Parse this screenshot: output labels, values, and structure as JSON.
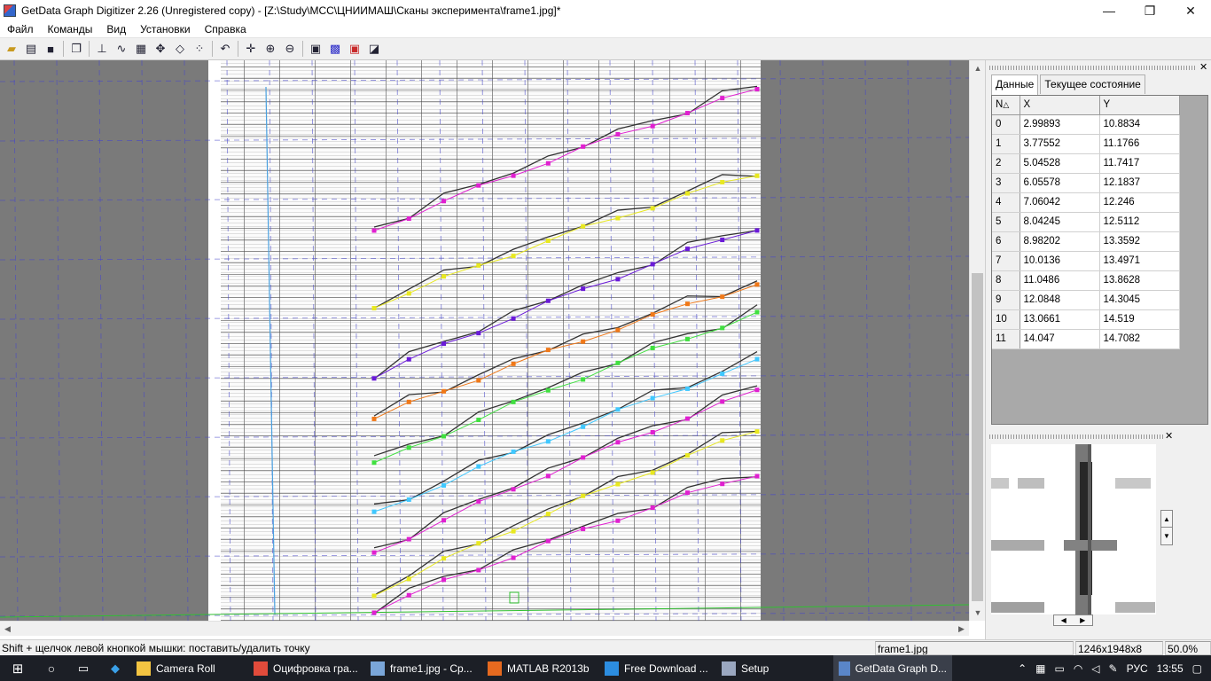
{
  "window": {
    "title": "GetData Graph Digitizer 2.26 (Unregistered copy) - [Z:\\Study\\МСС\\ЦНИИМАШ\\Сканы эксперимента\\frame1.jpg]*",
    "minimize": "—",
    "maximize": "❐",
    "close": "✕"
  },
  "menu": [
    "Файл",
    "Команды",
    "Вид",
    "Установки",
    "Справка"
  ],
  "toolbar_icons": [
    "open-icon",
    "scan-icon",
    "save-icon",
    "copy-icon",
    "axis-icon",
    "line-digitize-icon",
    "area-digitize-icon",
    "point-capture-icon",
    "eraser-icon",
    "point-sort-icon",
    "undo-icon",
    "move-icon",
    "zoom-in-icon",
    "zoom-out-icon",
    "image-icon",
    "grid-icon",
    "points-icon",
    "fit-icon"
  ],
  "panel": {
    "tabs": [
      "Данные",
      "Текущее состояние"
    ],
    "columns": [
      "N",
      "X",
      "Y"
    ],
    "rows": [
      [
        "0",
        "2.99893",
        "10.8834"
      ],
      [
        "1",
        "3.77552",
        "11.1766"
      ],
      [
        "2",
        "5.04528",
        "11.7417"
      ],
      [
        "3",
        "6.05578",
        "12.1837"
      ],
      [
        "4",
        "7.06042",
        "12.246"
      ],
      [
        "5",
        "8.04245",
        "12.5112"
      ],
      [
        "6",
        "8.98202",
        "13.3592"
      ],
      [
        "7",
        "10.0136",
        "13.4971"
      ],
      [
        "8",
        "11.0486",
        "13.8628"
      ],
      [
        "9",
        "12.0848",
        "14.3045"
      ],
      [
        "10",
        "13.0661",
        "14.519"
      ],
      [
        "11",
        "14.047",
        "14.7082"
      ]
    ]
  },
  "status": {
    "hint": "Shift + щелчок левой кнопкой мышки: поставить/удалить точку",
    "file": "frame1.jpg",
    "size": "1246x1948x8",
    "zoom": "50.0%"
  },
  "taskbar": {
    "items": [
      {
        "label": "Camera Roll",
        "icon": "folder-icon",
        "color": "#f4c542"
      },
      {
        "label": "Оцифровка гра...",
        "icon": "chrome-icon",
        "color": "#e14b3b"
      },
      {
        "label": "frame1.jpg - Ср...",
        "icon": "image-viewer-icon",
        "color": "#7aa6d9"
      },
      {
        "label": "MATLAB R2013b",
        "icon": "matlab-icon",
        "color": "#e66a1f"
      },
      {
        "label": "Free Download ...",
        "icon": "browser-icon",
        "color": "#2c8de0"
      },
      {
        "label": "Setup",
        "icon": "setup-icon",
        "color": "#9aa7c0"
      },
      {
        "label": "GetData Graph D...",
        "icon": "getdata-icon",
        "color": "#5a86c8"
      }
    ],
    "language": "РУС",
    "time": "13:55"
  },
  "colors": {
    "curve_magenta": "#e020d0",
    "curve_yellow": "#e8e820",
    "curve_purple": "#6a1ad8",
    "curve_orange": "#f07818",
    "curve_green": "#40e040",
    "curve_cyan": "#40c8ff",
    "axis_line": "#4aa0e0",
    "x_axis_green": "#30c030",
    "guide_grid": "#4848c8"
  }
}
